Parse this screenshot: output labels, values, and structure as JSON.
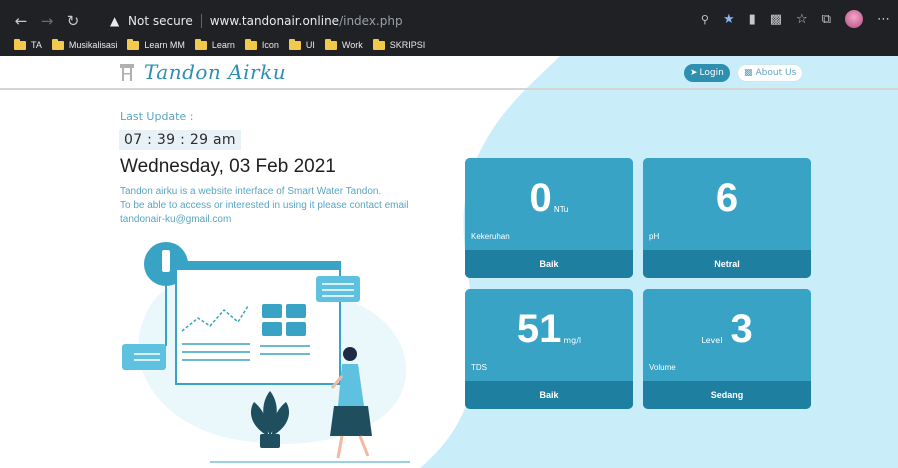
{
  "browser": {
    "security_label": "Not secure",
    "url_host": "www.tandonair.online",
    "url_path": "/index.php",
    "bookmarks": [
      "TA",
      "Musikalisasi",
      "Learn MM",
      "Learn",
      "Icon",
      "UI",
      "Work",
      "SKRIPSI"
    ]
  },
  "nav": {
    "brand": "Tandon Airku",
    "login_label": "Login",
    "about_label": "About Us"
  },
  "main": {
    "last_update_label": "Last Update :",
    "time": "07 : 39 : 29 am",
    "date": "Wednesday, 03 Feb 2021",
    "desc_line1": "Tandon airku is a website interface of Smart Water Tandon.",
    "desc_line2": "To be able to access or interested in using it please contact email",
    "desc_line3": "tandonair-ku@gmail.com"
  },
  "cards": [
    {
      "value": "0",
      "unit": "NTu",
      "prefix": "",
      "label": "Kekeruhan",
      "status": "Baik"
    },
    {
      "value": "6",
      "unit": "",
      "prefix": "",
      "label": "pH",
      "status": "Netral"
    },
    {
      "value": "51",
      "unit": "mg/l",
      "prefix": "",
      "label": "TDS",
      "status": "Baik"
    },
    {
      "value": "3",
      "unit": "",
      "prefix": "Level",
      "label": "Volume",
      "status": "Sedang"
    }
  ],
  "colors": {
    "accent": "#38a3c4",
    "accent_dark": "#1f7fa1",
    "blob": "#c9eef9"
  }
}
